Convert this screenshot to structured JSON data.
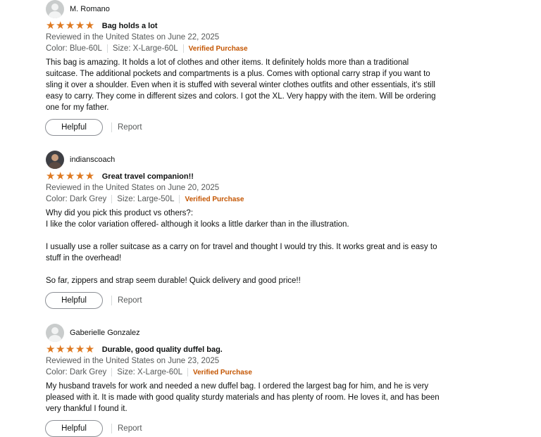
{
  "reviews": [
    {
      "reviewer": "M. Romano",
      "avatar_icon": "default-avatar-icon",
      "rating": 5,
      "stars": "★★★★★",
      "title": "Bag holds a lot",
      "date_line": "Reviewed in the United States on June 22, 2025",
      "color": "Color: Blue-60L",
      "size": "Size: X-Large-60L",
      "verified": "Verified Purchase",
      "body": "This bag is amazing. It holds a lot of clothes and other items. It definitely holds more than a traditional suitcase. The additional pockets and compartments is a plus. Comes with optional carry strap if you want to sling it over a shoulder. Even when it is stuffed with several winter clothes outfits and other essentials, it's still easy to carry. They come in different sizes and colors. I got the XL. Very happy with the item. Will be ordering one for my father.",
      "helpful_label": "Helpful",
      "report_label": "Report"
    },
    {
      "reviewer": "indianscoach",
      "avatar_icon": "profile-photo-icon",
      "rating": 5,
      "stars": "★★★★★",
      "title": "Great travel companion!!",
      "date_line": "Reviewed in the United States on June 20, 2025",
      "color": "Color: Dark Grey",
      "size": "Size: Large-50L",
      "verified": "Verified Purchase",
      "body": "Why did you pick this product vs others?:\nI like the color variation offered- although it looks a little darker than in the illustration.\n\nI usually use a roller suitcase as a carry on for travel and thought I would try this. It works great and is easy to stuff in the overhead!\n\nSo far, zippers and strap seem durable! Quick delivery and good price!!",
      "helpful_label": "Helpful",
      "report_label": "Report"
    },
    {
      "reviewer": "Gaberielle Gonzalez",
      "avatar_icon": "default-avatar-icon",
      "rating": 5,
      "stars": "★★★★★",
      "title": "Durable, good quality duffel bag.",
      "date_line": "Reviewed in the United States on June 23, 2025",
      "color": "Color: Dark Grey",
      "size": "Size: X-Large-60L",
      "verified": "Verified Purchase",
      "body": "My husband travels for work and needed a new duffel bag. I ordered the largest bag for him, and he is very pleased with it. It is made with good quality sturdy materials and has plenty of room. He loves it, and has been very thankful I found it.",
      "helpful_label": "Helpful",
      "report_label": "Report"
    }
  ],
  "colors": {
    "star": "#de7921",
    "verified": "#c45500",
    "meta": "#565959"
  }
}
